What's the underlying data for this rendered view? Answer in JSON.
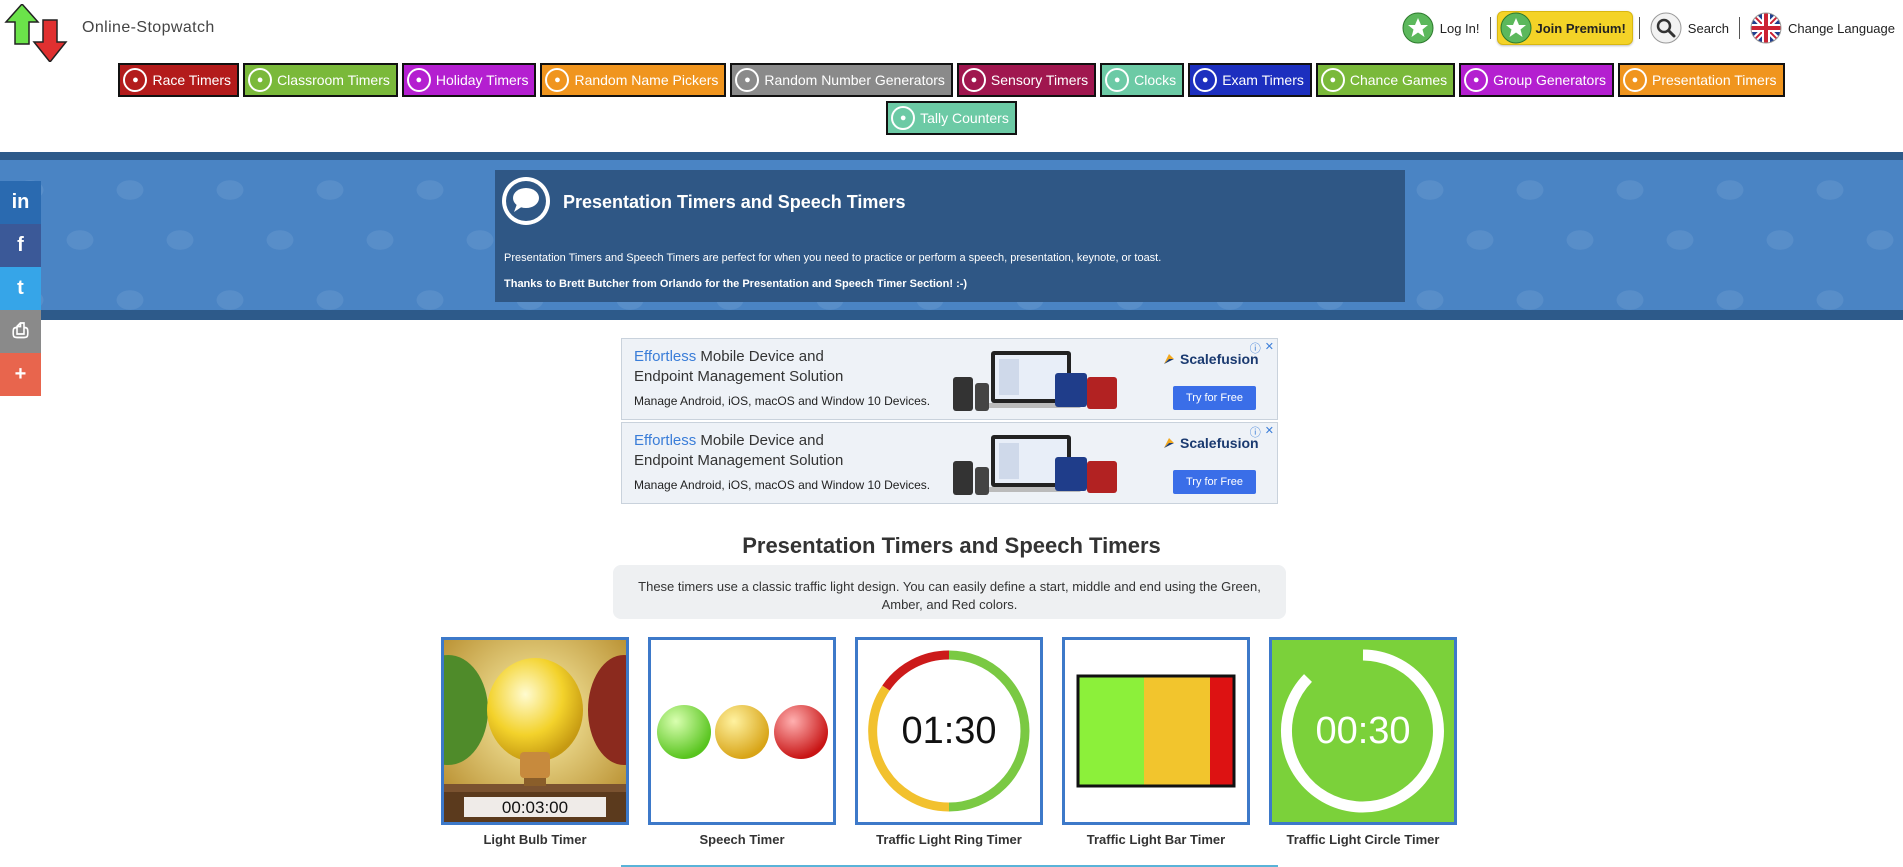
{
  "header": {
    "site_name": "Online-Stopwatch",
    "login_label": "Log In!",
    "premium_label": "Join Premium!",
    "search_label": "Search",
    "language_label": "Change Language"
  },
  "categories": [
    {
      "label": "Race Timers",
      "color": "#b31b1b"
    },
    {
      "label": "Classroom Timers",
      "color": "#7ab93a"
    },
    {
      "label": "Holiday Timers",
      "color": "#b41fd0"
    },
    {
      "label": "Random Name Pickers",
      "color": "#f0951e"
    },
    {
      "label": "Random Number Generators",
      "color": "#8a8a8a"
    },
    {
      "label": "Sensory Timers",
      "color": "#a0174f"
    },
    {
      "label": "Clocks",
      "color": "#6ccaa5"
    },
    {
      "label": "Exam Timers",
      "color": "#1c2fbf"
    },
    {
      "label": "Chance Games",
      "color": "#7ab93a"
    },
    {
      "label": "Group Generators",
      "color": "#b41fd0"
    },
    {
      "label": "Presentation Timers",
      "color": "#f0951e"
    },
    {
      "label": "Tally Counters",
      "color": "#6ccaa5"
    }
  ],
  "banner": {
    "title": "Presentation Timers and Speech Timers",
    "description": "Presentation Timers and Speech Timers are perfect for when you need to practice or perform a speech, presentation, keynote, or toast.",
    "thanks": "Thanks to Brett Butcher from Orlando for the Presentation and Speech Timer Section! :-)"
  },
  "social": [
    {
      "name": "linkedin",
      "glyph": "in",
      "color": "#2a6ab0"
    },
    {
      "name": "facebook",
      "glyph": "f",
      "color": "#3b5998"
    },
    {
      "name": "twitter",
      "glyph": "t",
      "color": "#36a5e8"
    },
    {
      "name": "print",
      "glyph": "⎙",
      "color": "#8a8a8a"
    },
    {
      "name": "more",
      "glyph": "+",
      "color": "#e8654d"
    }
  ],
  "ads": [
    {
      "highlight": "Effortless",
      "headline_rest": " Mobile Device and",
      "headline_line2": "Endpoint Management Solution",
      "sub": "Manage Android, iOS, macOS and Window 10 Devices.",
      "brand": "Scalefusion",
      "cta": "Try for Free"
    },
    {
      "highlight": "Effortless",
      "headline_rest": " Mobile Device and",
      "headline_line2": "Endpoint Management Solution",
      "sub": "Manage Android, iOS, macOS and Window 10 Devices.",
      "brand": "Scalefusion",
      "cta": "Try for Free"
    }
  ],
  "section": {
    "title": "Presentation Timers and Speech Timers",
    "description": "These timers use a classic traffic light design. You can easily define a start, middle and end using the Green, Amber, and Red colors."
  },
  "timers": [
    {
      "caption": "Light Bulb Timer",
      "display": "00:03:00"
    },
    {
      "caption": "Speech Timer"
    },
    {
      "caption": "Traffic Light Ring Timer",
      "display": "01:30"
    },
    {
      "caption": "Traffic Light Bar Timer"
    },
    {
      "caption": "Traffic Light Circle Timer",
      "display": "00:30"
    }
  ]
}
